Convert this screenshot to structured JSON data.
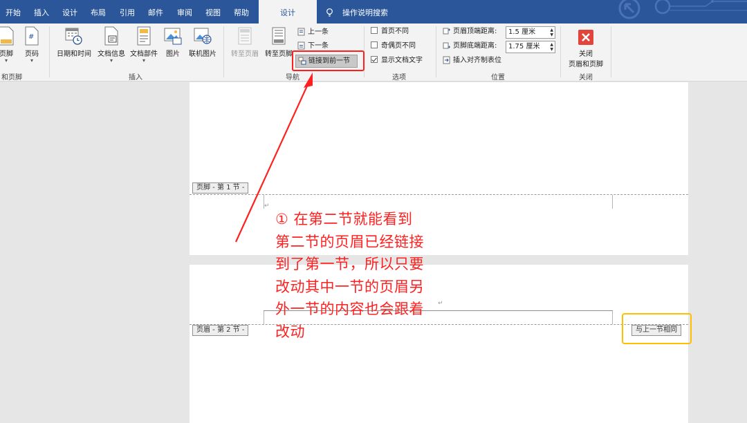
{
  "tabs": [
    {
      "label": "开始"
    },
    {
      "label": "插入"
    },
    {
      "label": "设计"
    },
    {
      "label": "布局"
    },
    {
      "label": "引用"
    },
    {
      "label": "邮件"
    },
    {
      "label": "审阅"
    },
    {
      "label": "视图"
    },
    {
      "label": "帮助"
    },
    {
      "label": "设计",
      "active": true
    }
  ],
  "tell_me": "操作说明搜索",
  "ribbon": {
    "group1": {
      "label": "和页脚",
      "buttons": [
        {
          "label": "页脚"
        },
        {
          "label": "页码"
        }
      ]
    },
    "insert": {
      "label": "插入",
      "buttons": [
        {
          "label": "日期和时间"
        },
        {
          "label": "文档信息"
        },
        {
          "label": "文档部件"
        },
        {
          "label": "图片"
        },
        {
          "label": "联机图片"
        }
      ]
    },
    "navigation": {
      "label": "导航",
      "goto_header": "转至页眉",
      "goto_footer": "转至页脚",
      "previous": "上一条",
      "next": "下一条",
      "link_to_previous": "链接到前一节"
    },
    "options": {
      "label": "选项",
      "items": [
        {
          "label": "首页不同",
          "checked": false
        },
        {
          "label": "奇偶页不同",
          "checked": false
        },
        {
          "label": "显示文档文字",
          "checked": true
        }
      ]
    },
    "position": {
      "label": "位置",
      "header_top_label": "页眉顶端距离:",
      "header_top_value": "1.5 厘米",
      "footer_bottom_label": "页脚底端距离:",
      "footer_bottom_value": "1.75 厘米",
      "insert_align_tab": "插入对齐制表位"
    },
    "close": {
      "label": "关闭",
      "button_line1": "关闭",
      "button_line2": "页眉和页脚"
    }
  },
  "document": {
    "footer_tag_section1": "页脚 - 第 1 节 -",
    "header_tag_section2": "页眉 - 第 2 节 -",
    "same_as_previous": "与上一节相同"
  },
  "annotation": {
    "text_lines": [
      "①  在第二节就能看到",
      "第二节的页眉已经链接",
      "到了第一节，所以只要",
      "改动其中一节的页眉另",
      "外一节的内容也会跟着",
      "改动"
    ]
  },
  "colors": {
    "tab_bar": "#2b579a",
    "ribbon_bg": "#f3f3f3",
    "annotation_red": "#ff2020",
    "highlight_yellow": "#ffbf00"
  }
}
